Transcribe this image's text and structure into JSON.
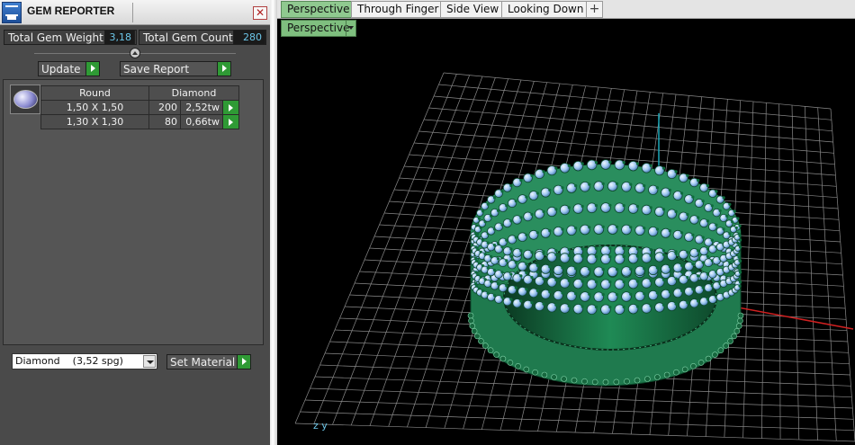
{
  "window": {
    "title": "GEM REPORTER"
  },
  "stats": {
    "total_weight_label": "Total Gem Weight",
    "total_weight_value": "3,18",
    "total_count_label": "Total Gem Count",
    "total_count_value": "280"
  },
  "actions": {
    "update_label": "Update",
    "save_report_label": "Save Report"
  },
  "report": {
    "gem_icon": "round-gem-icon",
    "headers": [
      "Round",
      "Diamond"
    ],
    "rows": [
      {
        "size": "1,50 X 1,50",
        "count": "200",
        "weight": "2,52tw"
      },
      {
        "size": "1,30 X 1,30",
        "count": "80",
        "weight": "0,66tw"
      }
    ]
  },
  "material": {
    "selected": "Diamond    (3,52 spg)",
    "set_material_label": "Set Material"
  },
  "viewport": {
    "tabs": [
      "Perspective",
      "Through Finger",
      "Side View",
      "Looking Down"
    ],
    "active_tab": "Perspective",
    "view_mode": "Perspective",
    "axis_label": "z y"
  },
  "colors": {
    "accent_green": "#2f9a35",
    "value_blue": "#6cc6e8",
    "ring_green": "#1f7a4e",
    "gem_blue": "#9ec6f0"
  }
}
